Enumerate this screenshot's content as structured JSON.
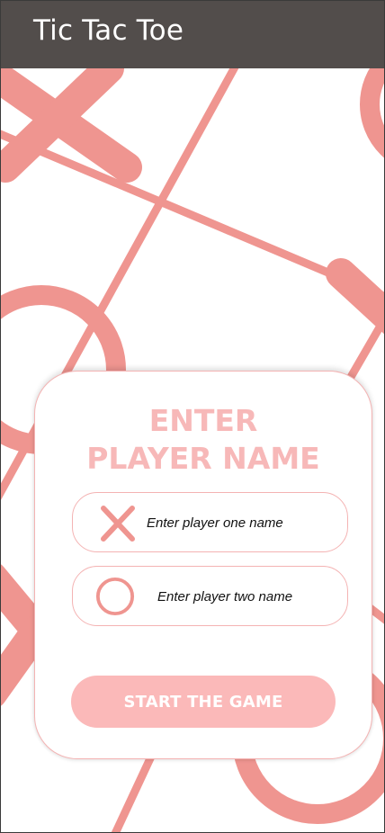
{
  "app_bar": {
    "title": "Tic Tac Toe",
    "background": "#524d4b"
  },
  "card": {
    "heading_line1": "ENTER",
    "heading_line2": "PLAYER NAME",
    "player_one": {
      "icon": "x-mark-icon",
      "placeholder": "Enter player one name",
      "value": ""
    },
    "player_two": {
      "icon": "o-mark-icon",
      "placeholder": "Enter player two name",
      "value": ""
    },
    "start_label": "START THE GAME"
  },
  "colors": {
    "accent": "#f7b8b8",
    "pattern": "#ef9590",
    "button": "#fbb9b9"
  }
}
